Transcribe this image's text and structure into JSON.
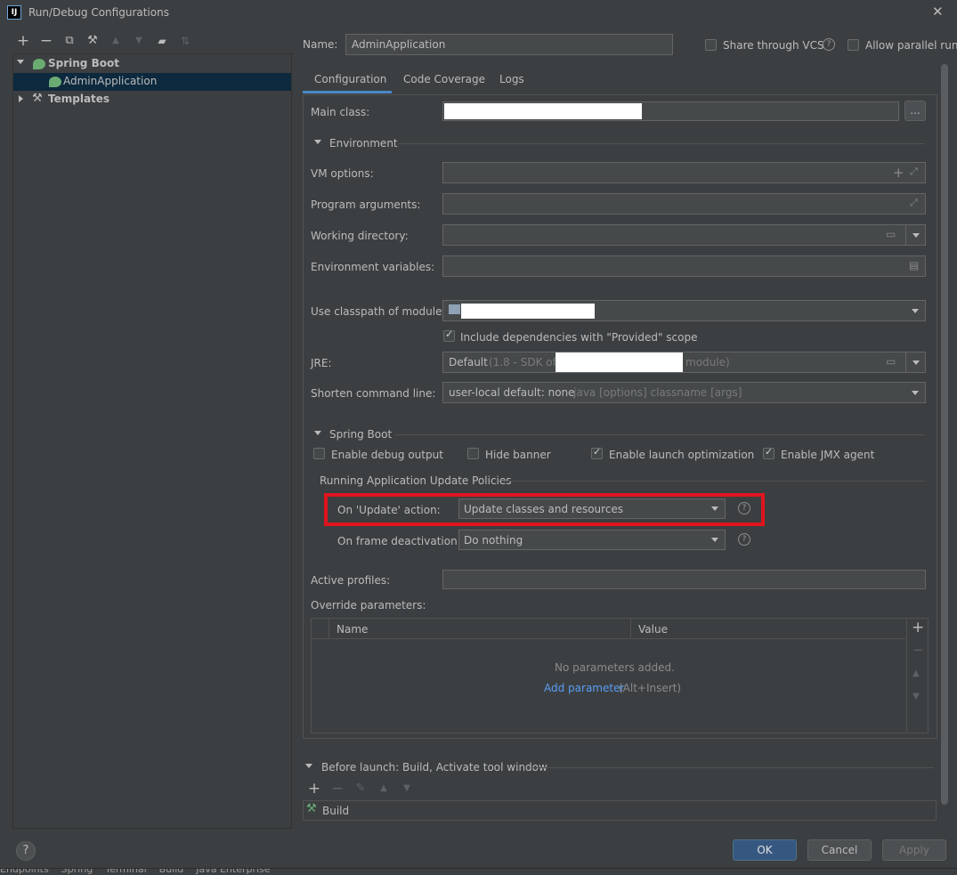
{
  "window": {
    "title": "Run/Debug Configurations",
    "close_glyph": "✕"
  },
  "toolbar": {
    "add": "+",
    "remove": "−",
    "copy": "⧉",
    "wrench": "🔧",
    "up": "▲",
    "down": "▼",
    "folder": "📁",
    "sort": "⇅"
  },
  "tree": {
    "spring_boot": "Spring Boot",
    "admin_app": "AdminApplication",
    "templates": "Templates"
  },
  "header": {
    "name_label": "Name:",
    "name_value": "AdminApplication",
    "share_vcs": "Share through VCS",
    "allow_parallel": "Allow parallel run"
  },
  "tabs": [
    "Configuration",
    "Code Coverage",
    "Logs"
  ],
  "form": {
    "main_class_label": "Main class:",
    "browse_label": "...",
    "environment_section": "Environment",
    "vm_options_label": "VM options:",
    "program_args_label": "Program arguments:",
    "working_dir_label": "Working directory:",
    "env_vars_label": "Environment variables:",
    "classpath_label": "Use classpath of module:",
    "include_deps_label": "Include dependencies with \"Provided\" scope",
    "jre_label": "JRE:",
    "jre_default": "Default",
    "jre_hint_a": "(1.8 - SDK of",
    "jre_hint_b": "module)",
    "shorten_label": "Shorten command line:",
    "shorten_value": "user-local default: none",
    "shorten_hint": "- java [options] classname [args]"
  },
  "spring": {
    "section": "Spring Boot",
    "debug_output": "Enable debug output",
    "hide_banner": "Hide banner",
    "launch_opt": "Enable launch optimization",
    "jmx_agent": "Enable JMX agent",
    "policies_title": "Running Application Update Policies",
    "on_update_label": "On 'Update' action:",
    "on_update_value": "Update classes and resources",
    "on_frame_label": "On frame deactivation:",
    "on_frame_value": "Do nothing",
    "highlight_color": "#e0141e"
  },
  "profiles": {
    "active_label": "Active profiles:",
    "override_label": "Override parameters:",
    "col_name": "Name",
    "col_value": "Value",
    "empty_text": "No parameters added.",
    "add_link": "Add parameter",
    "add_shortcut": "(Alt+Insert)"
  },
  "before_launch": {
    "title": "Before launch: Build, Activate tool window",
    "item": "Build"
  },
  "footer": {
    "help": "?",
    "ok": "OK",
    "cancel": "Cancel",
    "apply": "Apply",
    "bottom_strip": "Endpoints    Spring    Terminal    Build    Java Enterprise"
  },
  "colors": {
    "accent": "#4a88c7",
    "selection": "#0d293e",
    "ok_button": "#365880"
  }
}
